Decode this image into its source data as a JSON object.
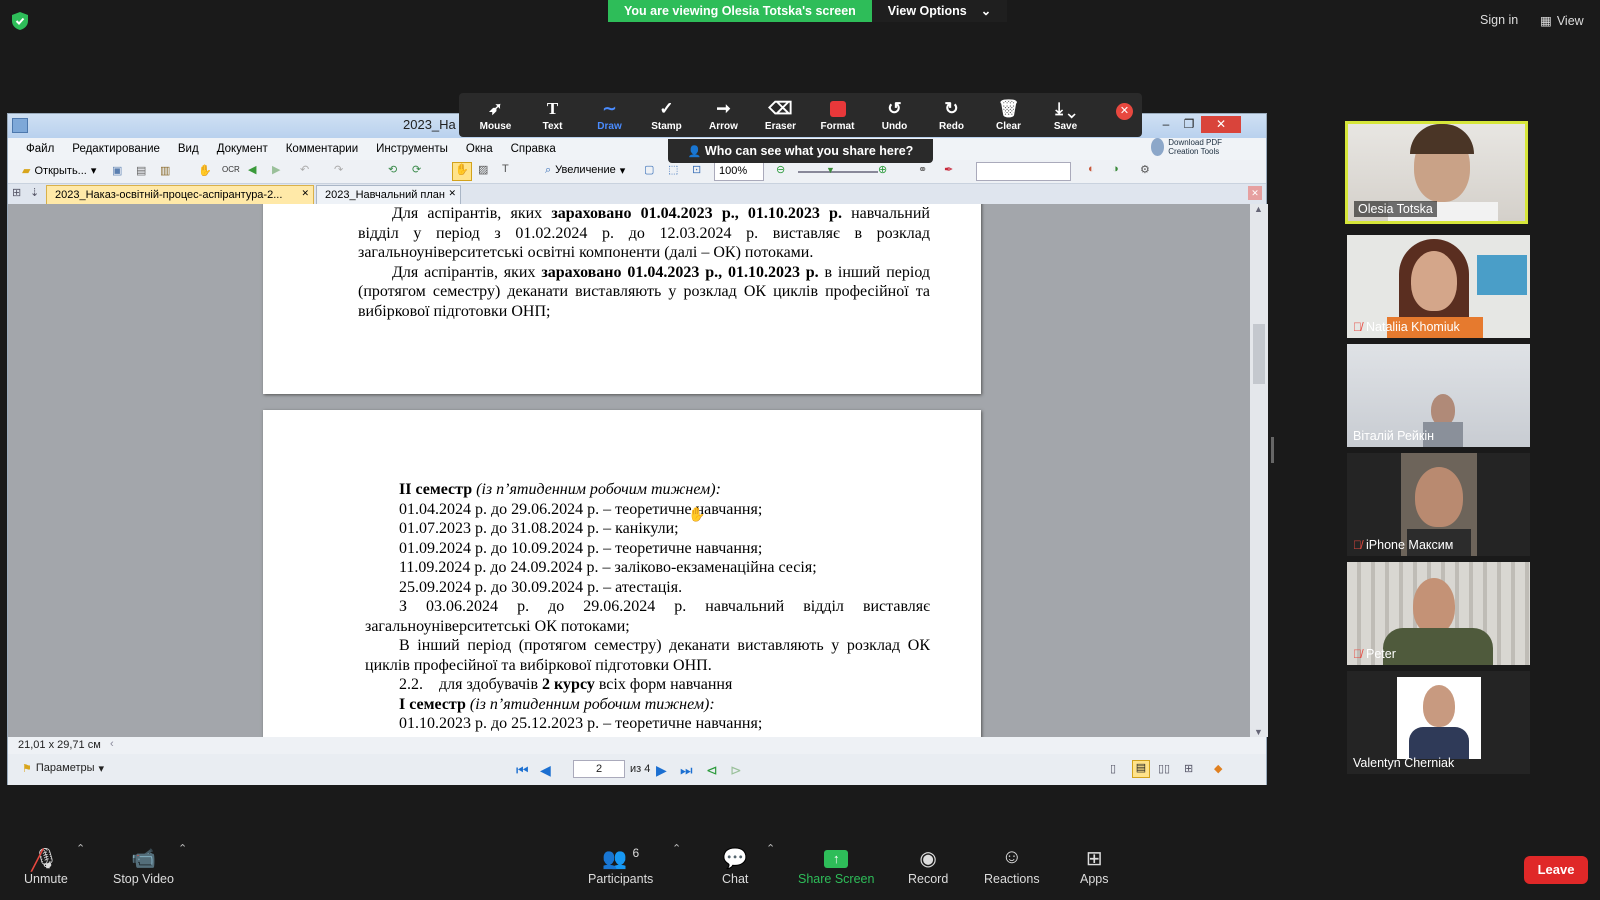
{
  "topbar": {
    "viewing_banner": "You are viewing Olesia Totska's screen",
    "view_options": "View Options",
    "sign_in": "Sign in",
    "view": "View"
  },
  "annotation_toolbar": {
    "tools": [
      {
        "label": "Mouse",
        "icon": "pointer-icon"
      },
      {
        "label": "Text",
        "icon": "text-icon"
      },
      {
        "label": "Draw",
        "icon": "draw-icon",
        "active": true
      },
      {
        "label": "Stamp",
        "icon": "stamp-icon"
      },
      {
        "label": "Arrow",
        "icon": "arrow-icon"
      },
      {
        "label": "Eraser",
        "icon": "eraser-icon"
      },
      {
        "label": "Format",
        "icon": "format-icon"
      },
      {
        "label": "Undo",
        "icon": "undo-icon"
      },
      {
        "label": "Redo",
        "icon": "redo-icon"
      },
      {
        "label": "Clear",
        "icon": "trash-icon"
      },
      {
        "label": "Save",
        "icon": "save-icon"
      }
    ],
    "who_can_see": "Who can see what you share here?"
  },
  "pdf_app": {
    "title": "2023_На",
    "menu": [
      "Файл",
      "Редактирование",
      "Вид",
      "Документ",
      "Комментарии",
      "Инструменты",
      "Окна",
      "Справка"
    ],
    "toolbar": {
      "open": "Открыть...",
      "zoom_label": "Увеличение",
      "zoom_value": "100%",
      "download_promo": "Download PDF Creation Tools"
    },
    "tabs": [
      {
        "label": "2023_Наказ-освітній-процес-аспірантура-2...",
        "active": true
      },
      {
        "label": "2023_Навчальний план",
        "active": false
      }
    ],
    "page1_lines": [
      {
        "pre": "Для аспірантів, яких ",
        "bold": "зараховано 01.04.2023 р., 01.10.2023 р.",
        "post": " навчальний відділ у період з 01.02.2024 р. до 12.03.2024 р. виставляє в розклад загальноуніверситетські освітні компоненти (далі – ОК) потоками."
      },
      {
        "pre": "Для аспірантів, яких ",
        "bold": "зараховано 01.04.2023 р., 01.10.2023 р.",
        "post": " в інший період (протягом семестру) деканати виставляють у розклад ОК циклів професійної та вибіркової підготовки ОНП;"
      }
    ],
    "page2": {
      "semester2_title": "II семестр",
      "semester2_note": "(із п’ятиденним робочим тижнем):",
      "schedule": [
        "01.04.2024 р. до 29.06.2024 р. – теоретичне навчання;",
        "01.07.2023 р. до 31.08.2024 р. – канікули;",
        "01.09.2024 р. до 10.09.2024 р. – теоретичне навчання;",
        "11.09.2024 р. до 24.09.2024 р. – заліково-екзаменаційна сесія;",
        "25.09.2024 р. до 30.09.2024 р. – атестація."
      ],
      "para1": "З 03.06.2024 р. до 29.06.2024 р. навчальний відділ виставляє загальноуніверситетські ОК потоками;",
      "para2": "В інший період (протягом семестру) деканати виставляють у розклад ОК циклів професійної та вибіркової підготовки ОНП.",
      "item_num": "2.2.",
      "item_pre": "для здобувачів ",
      "item_bold": "2 курсу",
      "item_post": " всіх форм навчання",
      "semester1_title": "I семестр",
      "semester1_note": "(із п’ятиденним робочим тижнем):",
      "last_line": "01.10.2023 р. до 25.12.2023 р. – теоретичне навчання;"
    },
    "status": {
      "page_size": "21,01 x 29,71 см",
      "params": "Параметры",
      "page_current": "2",
      "page_total": "из 4"
    }
  },
  "participants": [
    {
      "name": "Olesia Totska",
      "muted": false,
      "active_speaker": true
    },
    {
      "name": "Nataliia Khomiuk",
      "muted": true
    },
    {
      "name": "Віталій Рейкін",
      "muted": false
    },
    {
      "name": "iPhone Максим",
      "muted": true
    },
    {
      "name": "Peter",
      "muted": true
    },
    {
      "name": "Valentyn Cherniak",
      "muted": false
    }
  ],
  "bottombar": {
    "unmute": "Unmute",
    "stop_video": "Stop Video",
    "participants": "Participants",
    "participants_count": "6",
    "chat": "Chat",
    "share_screen": "Share Screen",
    "record": "Record",
    "reactions": "Reactions",
    "apps": "Apps",
    "leave": "Leave"
  },
  "colors": {
    "zoom_green": "#2ebd59",
    "leave_red": "#e02828",
    "active_speaker": "#d6e63a",
    "draw_active": "#4a8cff"
  }
}
